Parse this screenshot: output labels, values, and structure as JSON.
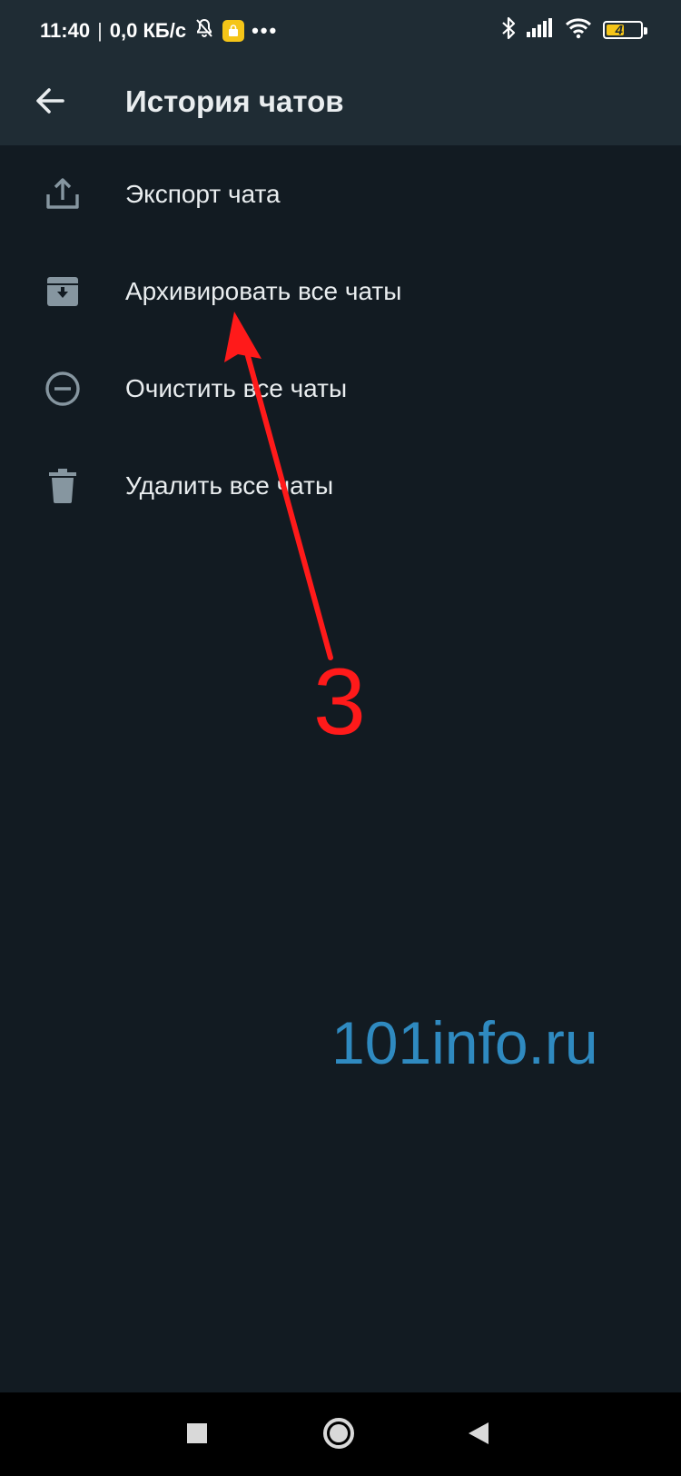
{
  "status_bar": {
    "time": "11:40",
    "separator": "|",
    "network_speed": "0,0 КБ/с",
    "more": "•••",
    "battery_level": "47",
    "icons": [
      "bell-off-icon",
      "app-badge-icon",
      "bluetooth-icon",
      "signal-icon",
      "wifi-icon",
      "battery-icon"
    ],
    "battery_color": "#f5c518"
  },
  "app_bar": {
    "title": "История чатов",
    "back_icon": "arrow-left-icon"
  },
  "menu": {
    "items": [
      {
        "label": "Экспорт чата",
        "icon": "export-icon"
      },
      {
        "label": "Архивировать все чаты",
        "icon": "archive-icon"
      },
      {
        "label": "Очистить все чаты",
        "icon": "minus-circle-icon"
      },
      {
        "label": "Удалить все чаты",
        "icon": "trash-icon"
      }
    ]
  },
  "annotation": {
    "number": "3",
    "color": "#ff1a1a"
  },
  "watermark": {
    "text": "101info.ru",
    "color": "#2f8ac0"
  },
  "nav_bar": {
    "buttons": [
      "recents-square-icon",
      "home-circle-icon",
      "back-triangle-icon"
    ]
  },
  "colors": {
    "background": "#121b22",
    "app_bar": "#1f2c34",
    "text": "#e9edef",
    "icon": "#8696a0"
  }
}
